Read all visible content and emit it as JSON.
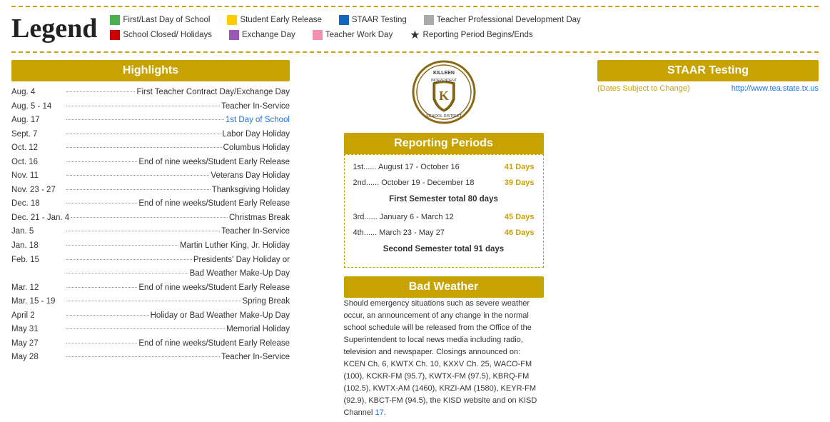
{
  "legend": {
    "title": "Legend",
    "items_row1": [
      {
        "color": "#4caf50",
        "label": "First/Last Day of School"
      },
      {
        "color": "#ffcc00",
        "label": "Student Early Release"
      },
      {
        "color": "#1565c0",
        "label": "STAAR Testing"
      },
      {
        "color": "#aaaaaa",
        "label": "Teacher Professional Development Day"
      }
    ],
    "items_row2": [
      {
        "color": "#cc0000",
        "label": "School Closed/ Holidays"
      },
      {
        "color": "#9b59b6",
        "label": "Exchange Day"
      },
      {
        "color": "#f48fb1",
        "label": "Teacher Work Day"
      },
      {
        "icon": "star",
        "label": "Reporting Period Begins/Ends"
      }
    ]
  },
  "highlights": {
    "header": "Highlights",
    "items": [
      {
        "date": "Aug. 4",
        "event": "First Teacher Contract Day/Exchange Day",
        "style": ""
      },
      {
        "date": "Aug. 5 - 14",
        "event": "Teacher In-Service",
        "style": ""
      },
      {
        "date": "Aug. 17",
        "event": "1st Day of School",
        "style": "blue"
      },
      {
        "date": "Sept. 7",
        "event": "Labor Day Holiday",
        "style": ""
      },
      {
        "date": "Oct. 12",
        "event": "Columbus Holiday",
        "style": ""
      },
      {
        "date": "Oct. 16",
        "event": "End of nine weeks/Student Early Release",
        "style": ""
      },
      {
        "date": "Nov. 11",
        "event": "Veterans Day Holiday",
        "style": ""
      },
      {
        "date": "Nov. 23 - 27",
        "event": "Thanksgiving Holiday",
        "style": ""
      },
      {
        "date": "Dec. 18",
        "event": "End of nine weeks/Student Early Release",
        "style": ""
      },
      {
        "date": "Dec. 21 - Jan. 4",
        "event": "Christmas Break",
        "style": ""
      },
      {
        "date": "Jan. 5",
        "event": "Teacher In-Service",
        "style": ""
      },
      {
        "date": "Jan. 18",
        "event": "Martin Luther King, Jr. Holiday",
        "style": ""
      },
      {
        "date": "Feb. 15",
        "event": "Presidents' Day Holiday or",
        "style": ""
      },
      {
        "date": "",
        "event": "Bad Weather Make-Up Day",
        "style": ""
      },
      {
        "date": "Mar. 12",
        "event": "End of nine weeks/Student Early Release",
        "style": ""
      },
      {
        "date": "Mar. 15 - 19",
        "event": "Spring Break",
        "style": ""
      },
      {
        "date": "April 2",
        "event": "Holiday or Bad Weather Make-Up Day",
        "style": ""
      },
      {
        "date": "May 31",
        "event": "Memorial Holiday",
        "style": ""
      },
      {
        "date": "May 27",
        "event": "End of nine weeks/Student Early Release",
        "style": ""
      },
      {
        "date": "May 28",
        "event": "Teacher In-Service",
        "style": ""
      }
    ]
  },
  "killeen_logo": {
    "alt": "Killeen Independent School District"
  },
  "reporting_periods": {
    "header": "Reporting Periods",
    "items": [
      {
        "num": "1st",
        "dates": "August 17 - October 16",
        "days": "41 Days"
      },
      {
        "num": "2nd",
        "dates": "October 19 - December 18",
        "days": "39 Days"
      },
      {
        "total1": "First Semester total 80 days"
      },
      {
        "num": "3rd",
        "dates": "January 6 - March 12",
        "days": "45 Days"
      },
      {
        "num": "4th",
        "dates": "March 23 - May 27",
        "days": "46 Days"
      },
      {
        "total2": "Second Semester total 91 days"
      }
    ]
  },
  "bad_weather": {
    "header": "Bad Weather",
    "text": "Should emergency situations such as severe weather occur, an announcement of any change in the normal school schedule will be released from the Office of the Superintendent to local news media including radio, television and newspaper. Closings announced on: KCEN Ch. 6, KWTX Ch. 10, KXXV Ch. 25, WACO-FM (100), KCKR-FM (95.7), KWTX-FM (97.5), KBRQ-FM (102.5), KWTX-AM (1460), KRZI-AM (1580), KEYR-FM (92.9), KBCT-FM (94.5), the KISD website and on KISD Channel",
    "channel_link": "17",
    "channel_suffix": "."
  },
  "staar_testing": {
    "header": "STAAR Testing",
    "dates_note": "(Dates Subject to Change)",
    "link_text": "http://www.tea.state.tx.us"
  }
}
